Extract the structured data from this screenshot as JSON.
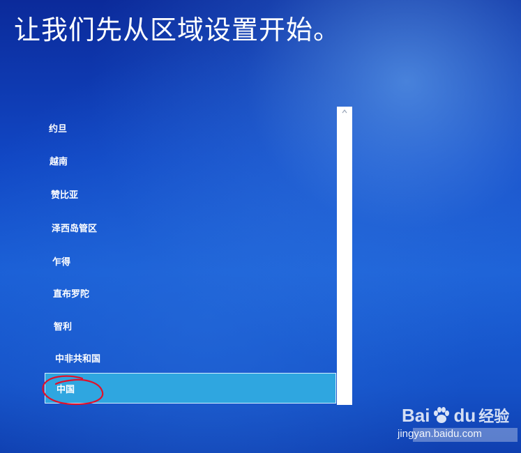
{
  "page": {
    "title": "让我们先从区域设置开始。"
  },
  "region_list": {
    "items": [
      {
        "label": "约旦",
        "selected": false
      },
      {
        "label": "越南",
        "selected": false
      },
      {
        "label": "赞比亚",
        "selected": false
      },
      {
        "label": "泽西岛管区",
        "selected": false
      },
      {
        "label": "乍得",
        "selected": false
      },
      {
        "label": "直布罗陀",
        "selected": false
      },
      {
        "label": "智利",
        "selected": false
      },
      {
        "label": "中非共和国",
        "selected": false
      },
      {
        "label": "中国",
        "selected": true
      }
    ]
  },
  "scrollbar": {
    "up_arrow_icon": "chevron-up-icon"
  },
  "annotation": {
    "color": "#e0102a",
    "shape": "hand-drawn-circle"
  },
  "watermark": {
    "logo_bai": "Bai",
    "logo_du": "du",
    "logo_jingyan": "经验",
    "url": "jingyan.baidu.com"
  },
  "colors": {
    "selected_background": "#2fa6e0",
    "background_blue": "#1552c8",
    "text": "#ffffff"
  }
}
